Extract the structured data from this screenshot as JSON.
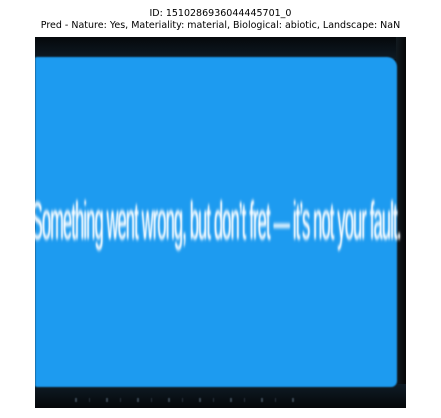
{
  "caption": {
    "id_line": "ID: 1510286936044445701_0",
    "pred_line": "Pred - Nature: Yes, Materiality: material, Biological: abiotic, Landscape: NaN"
  },
  "screenshot": {
    "message": "Something went wrong, but don’t fret — it’s not your fault.",
    "banner_color": "#1d9bf0",
    "text_color": "#ffffff"
  }
}
